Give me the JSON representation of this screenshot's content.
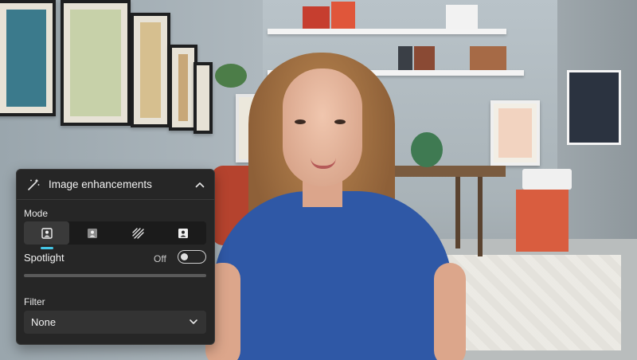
{
  "panel": {
    "title": "Image enhancements",
    "mode_label": "Mode",
    "modes": [
      "portrait-icon",
      "background-person-icon",
      "blur-lines-icon",
      "framed-person-icon"
    ],
    "selected_mode_index": 0,
    "spotlight": {
      "label": "Spotlight",
      "state": "Off",
      "enabled": false
    },
    "spotlight_level": 0,
    "filter": {
      "label": "Filter",
      "value": "None"
    }
  },
  "colors": {
    "panel_bg": "#262626",
    "accent": "#44c6e6"
  }
}
